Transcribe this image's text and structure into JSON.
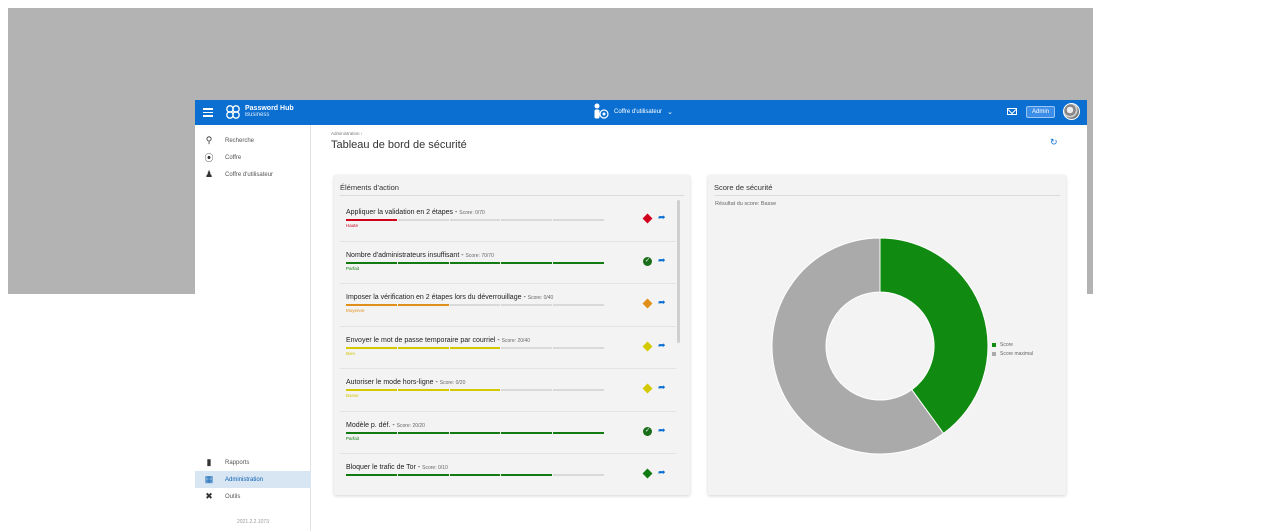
{
  "colors": {
    "brand": "#0a6fd1",
    "high": "#d0021b",
    "medium": "#e0901a",
    "good": "#d4c800",
    "perfect": "#117a11",
    "grey": "#aaaaaa"
  },
  "header": {
    "brand_name": "Password Hub",
    "brand_sub": "Business",
    "vault_label": "Coffre d'utilisateur",
    "admin_label": "Admin"
  },
  "sidebar": {
    "top": [
      {
        "label": "Recherche",
        "icon": "search-icon"
      },
      {
        "label": "Coffre",
        "icon": "vault-icon"
      },
      {
        "label": "Coffre d'utilisateur",
        "icon": "user-vault-icon"
      }
    ],
    "bottom": [
      {
        "label": "Rapports",
        "icon": "reports-icon"
      },
      {
        "label": "Administration",
        "icon": "administration-icon",
        "active": true
      },
      {
        "label": "Outils",
        "icon": "tools-icon"
      }
    ],
    "version": "2021.2.2.1073"
  },
  "main": {
    "breadcrumb": "Administration  ›",
    "title": "Tableau de bord de sécurité"
  },
  "actions": {
    "title": "Éléments d'action",
    "items": [
      {
        "title": "Appliquer la validation en 2 étapes",
        "score": "Score: 0/70",
        "level": "Haute",
        "level_color": "#d0021b",
        "fill": 1,
        "status": "high"
      },
      {
        "title": "Nombre d'administrateurs insuffisant",
        "score": "Score: 70/70",
        "level": "Parfait",
        "level_color": "#117a11",
        "fill": 5,
        "status": "ok"
      },
      {
        "title": "Imposer la vérification en 2 étapes lors du déverrouillage",
        "score": "Score: 0/40",
        "level": "Moyenne",
        "level_color": "#e0901a",
        "fill": 2,
        "status": "medium"
      },
      {
        "title": "Envoyer le mot de passe temporaire par courriel",
        "score": "Score: 20/40",
        "level": "Bien",
        "level_color": "#d4c800",
        "fill": 3,
        "status": "good"
      },
      {
        "title": "Autoriser le mode hors-ligne",
        "score": "Score: 0/20",
        "level": "Basse",
        "level_color": "#d4c800",
        "fill": 3,
        "status": "good"
      },
      {
        "title": "Modèle p. déf.",
        "score": "Score: 20/20",
        "level": "Parfait",
        "level_color": "#117a11",
        "fill": 5,
        "status": "ok"
      },
      {
        "title": "Bloquer le trafic de Tor",
        "score": "Score: 0/10",
        "level": "",
        "level_color": "#117a11",
        "fill": 4,
        "status": "perfect-diamond"
      }
    ]
  },
  "score_panel": {
    "title": "Score de sécurité",
    "result": "Résultat du score: Basse"
  },
  "chart_data": {
    "type": "pie",
    "title": "",
    "series": [
      {
        "name": "Score",
        "value": 40,
        "color": "#118a11"
      },
      {
        "name": "Score maximal",
        "value": 60,
        "color": "#aaaaaa"
      }
    ],
    "legend_position": "right"
  }
}
